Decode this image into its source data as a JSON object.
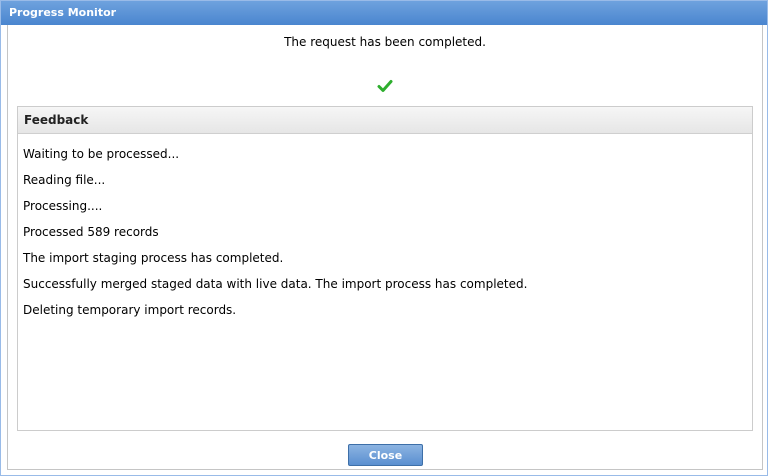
{
  "window": {
    "title": "Progress Monitor"
  },
  "status": {
    "message": "The request has been completed.",
    "icon": "checkmark-icon",
    "icon_color": "#2eae2e"
  },
  "feedback": {
    "title": "Feedback",
    "lines": [
      "Waiting to be processed...",
      "Reading file...",
      "Processing....",
      "Processed 589 records",
      "The import staging process has completed.",
      "Successfully merged staged data with live data. The import process has completed.",
      "Deleting temporary import records."
    ]
  },
  "actions": {
    "close_label": "Close"
  }
}
